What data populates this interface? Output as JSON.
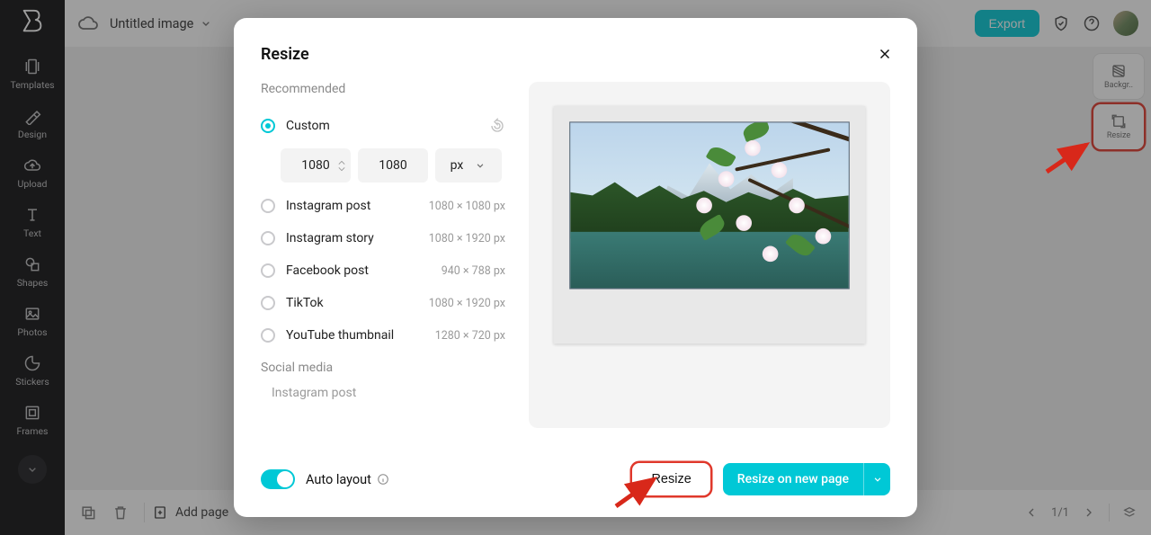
{
  "sidebar": {
    "items": [
      {
        "label": "Templates"
      },
      {
        "label": "Design"
      },
      {
        "label": "Upload"
      },
      {
        "label": "Text"
      },
      {
        "label": "Shapes"
      },
      {
        "label": "Photos"
      },
      {
        "label": "Stickers"
      },
      {
        "label": "Frames"
      }
    ]
  },
  "topbar": {
    "title": "Untitled image",
    "export": "Export"
  },
  "rightpanel": {
    "backgr": "Backgr..",
    "resize": "Resize"
  },
  "bottombar": {
    "addpage": "Add page",
    "pages": "1/1"
  },
  "modal": {
    "title": "Resize",
    "recommended_label": "Recommended",
    "custom_label": "Custom",
    "width": "1080",
    "height": "1080",
    "unit": "px",
    "options": [
      {
        "label": "Instagram post",
        "dim": "1080 × 1080 px"
      },
      {
        "label": "Instagram story",
        "dim": "1080 × 1920 px"
      },
      {
        "label": "Facebook post",
        "dim": "940 × 788 px"
      },
      {
        "label": "TikTok",
        "dim": "1080 × 1920 px"
      },
      {
        "label": "YouTube thumbnail",
        "dim": "1280 × 720 px"
      }
    ],
    "social_label": "Social media",
    "social_item": "Instagram post",
    "auto_layout": "Auto layout",
    "resize_btn": "Resize",
    "resize_new": "Resize on new page"
  }
}
